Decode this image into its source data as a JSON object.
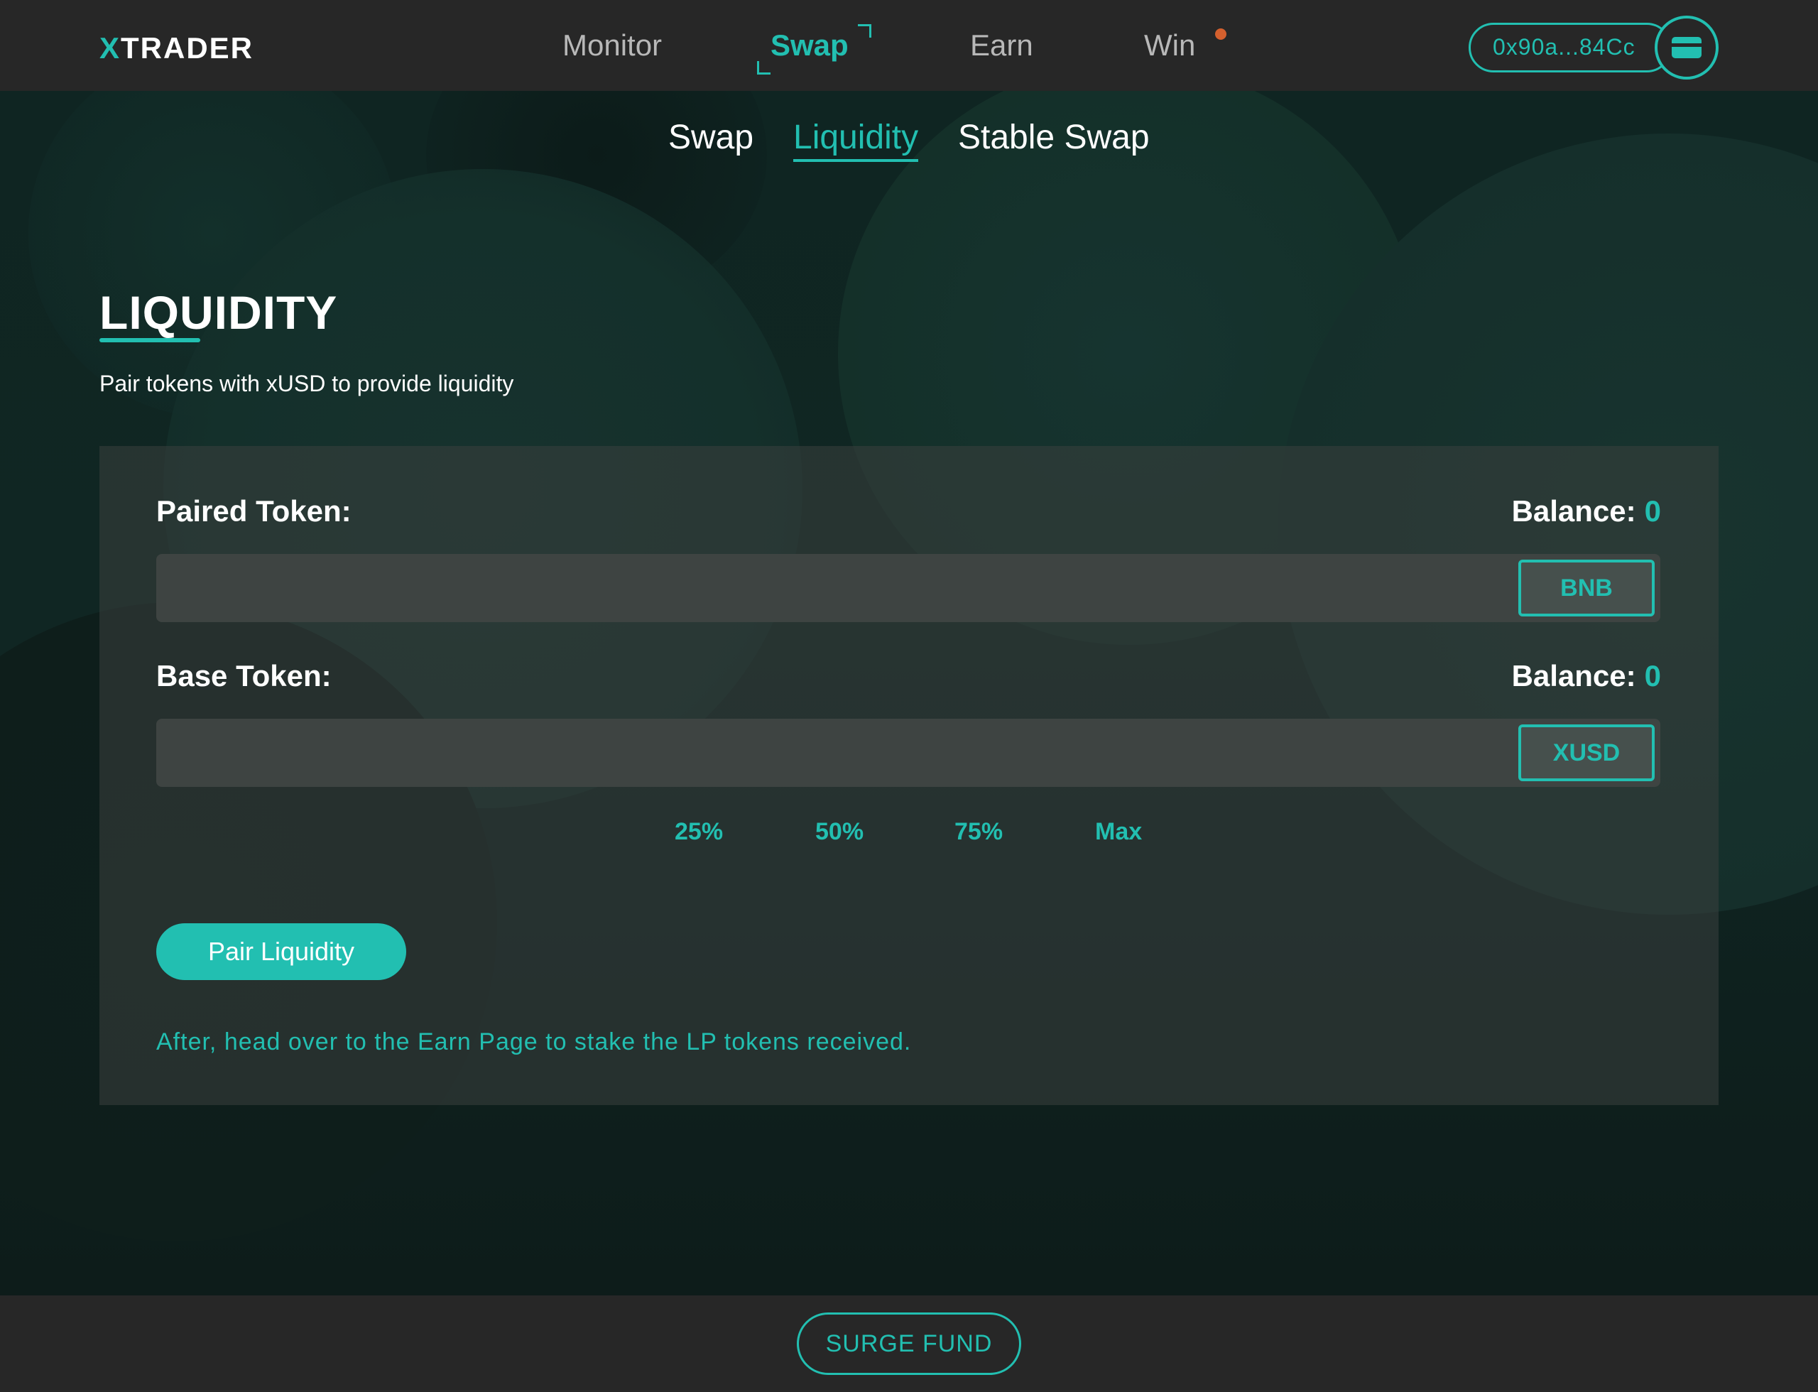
{
  "header": {
    "logo_x": "X",
    "logo_rest": "TRADER",
    "nav": {
      "monitor": "Monitor",
      "swap": "Swap",
      "earn": "Earn",
      "win": "Win"
    },
    "wallet_address": "0x90a...84Cc",
    "icons": {
      "wallet": "wallet-card-icon",
      "notification": "notification-dot-icon"
    }
  },
  "subtabs": {
    "swap": "Swap",
    "liquidity": "Liquidity",
    "stable_swap": "Stable Swap"
  },
  "page": {
    "title": "LIQUIDITY",
    "subtitle": "Pair tokens with xUSD to provide liquidity"
  },
  "form": {
    "paired": {
      "label": "Paired Token:",
      "balance_label": "Balance:",
      "balance_value": "0",
      "token": "BNB",
      "value": ""
    },
    "base": {
      "label": "Base Token:",
      "balance_label": "Balance:",
      "balance_value": "0",
      "token": "XUSD",
      "value": ""
    },
    "percentages": [
      "25%",
      "50%",
      "75%",
      "Max"
    ],
    "submit_label": "Pair Liquidity",
    "note": "After, head over to the Earn Page to stake the LP tokens received."
  },
  "footer": {
    "surge_fund": "SURGE FUND"
  },
  "colors": {
    "accent": "#22bfb1",
    "nav_bg": "#272727",
    "notification": "#d4602e"
  }
}
